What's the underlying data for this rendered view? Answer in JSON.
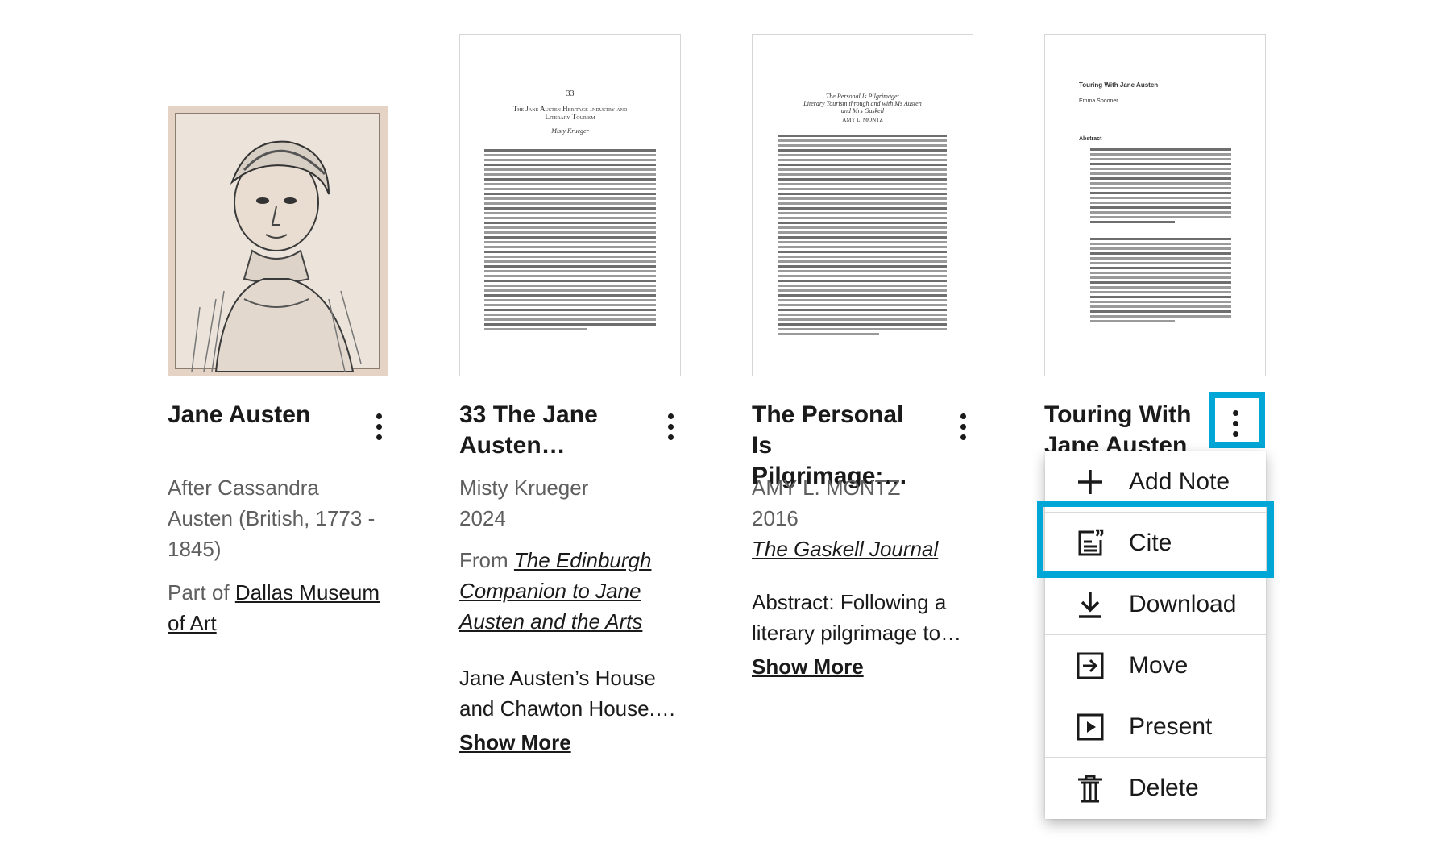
{
  "cards": [
    {
      "title": "Jane Austen",
      "meta_line1": "After Cassandra",
      "meta_line2": "Austen (British, 1773 -",
      "meta_line3": "1845)",
      "part_of_prefix": "Part of ",
      "part_of_link_1": "Dallas Museum",
      "part_of_link_2": "of Art"
    },
    {
      "title_line1": "33 The Jane",
      "title_line2": "Austen…",
      "author": "Misty Krueger",
      "year": "2024",
      "from_prefix": "From ",
      "from_link_1": "The Edinburgh",
      "from_link_2": "Companion to Jane",
      "from_link_3": "Austen and the Arts",
      "desc_line1": "Jane Austen’s House",
      "desc_line2": "and Chawton House.…",
      "show_more": "Show More",
      "thumb_page_number": "33",
      "thumb_heading_1": "The Jane Austen Heritage Industry and",
      "thumb_heading_2": "Literary Tourism",
      "thumb_author": "Misty Krueger"
    },
    {
      "title_line1": "The Personal Is",
      "title_line2": "Pilgrimage:…",
      "author": "AMY L. MONTZ",
      "year": "2016",
      "journal": "The Gaskell Journal",
      "desc_line1": "Abstract: Following a",
      "desc_line2": "literary pilgrimage to…",
      "show_more": "Show More",
      "thumb_heading_1": "The Personal Is Pilgrimage:",
      "thumb_heading_2": "Literary Tourism through and with Ms Austen",
      "thumb_heading_3": "and Mrs Gaskell",
      "thumb_author": "AMY L. MONTZ"
    },
    {
      "title_line1": "Touring With",
      "title_line2": "Jane Austen",
      "thumb_heading": "Touring With Jane Austen",
      "thumb_author": "Emma Spooner",
      "thumb_abstract": "Abstract"
    }
  ],
  "menu": {
    "items": [
      {
        "label": "Add Note",
        "icon": "plus-icon"
      },
      {
        "label": "Cite",
        "icon": "cite-icon"
      },
      {
        "label": "Download",
        "icon": "download-icon"
      },
      {
        "label": "Move",
        "icon": "move-icon"
      },
      {
        "label": "Present",
        "icon": "present-icon"
      },
      {
        "label": "Delete",
        "icon": "trash-icon"
      }
    ]
  },
  "colors": {
    "highlight": "#00a6d6",
    "text": "#1a1a1a",
    "muted": "#5f5f5f"
  }
}
